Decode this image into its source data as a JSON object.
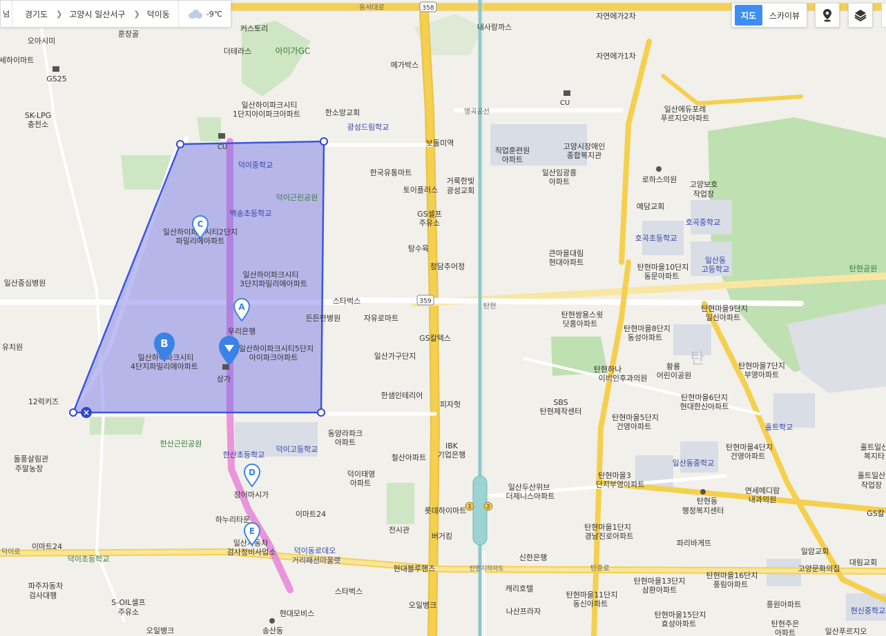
{
  "breadcrumb": {
    "edge": "넘",
    "province": "경기도",
    "city": "고양시 일산서구",
    "dong": "덕이동"
  },
  "weather": {
    "temp": "-9℃",
    "icon": "cloud-icon"
  },
  "view_toggle": {
    "map": "지도",
    "skyview": "스카이뷰",
    "selected": "지도"
  },
  "controls": {
    "location": "location-pin-icon",
    "layers": "layers-icon"
  },
  "colors": {
    "polygon_fill": "#6e6ee8",
    "polygon_stroke": "#3b55e0",
    "route": "#e889d9",
    "marker": "#3b82e6",
    "road_yellow": "#f5d04e",
    "subway": "#8fc8c8"
  },
  "markers": {
    "A": "A",
    "B": "B",
    "C": "C",
    "D": "D",
    "E": "E",
    "close": "×"
  },
  "roads": {
    "dongseo": "동서대로",
    "r358": "358",
    "r359": "359",
    "aengangongseon": "앵곡공선",
    "tanjungro": "탄중로",
    "deogiro": "덕이로",
    "ilsanro": "일산로",
    "tanhyeon_jihado": "탄현지하차도",
    "hwajeong": "화정로",
    "tanhyeonro": "탄현로",
    "misaro": "미래로",
    "tanhyeon": "탄현"
  },
  "labels": {
    "deogi_jung": "덕이중학교",
    "deogi_park": "덕이근린공원",
    "baeksong": "백송초등학교",
    "hipark2_a": "일산하이파크시티2단지",
    "hipark2_b": "파밀리에아파트",
    "hipark3_a": "일산하이파크시티",
    "hipark3_b": "3단지파밀리에아파트",
    "hipark4_a": "일산하이파크시티",
    "hipark4_b": "4단지파밀리에아파트",
    "hipark5_a": "일산하이파크시티5단지",
    "hipark5_b": "아이파크아파트",
    "hipark1_a": "일산하이파크시티",
    "hipark1_b": "1단지아이파크아파트",
    "woori": "우리은행",
    "sangga": "상가",
    "cu1": "CU",
    "cu2": "CU",
    "hansan_school": "한산초등학교",
    "deogi_high": "덕이고등학교",
    "hansan_park": "한산근린공원",
    "jangeomasi": "장어마시가",
    "hanuritaun": "하누리타운",
    "ilsan_car_a": "일산자동차",
    "ilsan_car_b": "검사정비사업소",
    "emart24_1": "이마트24",
    "emart24_2": "이마트24",
    "deogi_fashion_a": "덕이동로데오",
    "deogi_fashion_b": "거리패션아울렛",
    "deogi_elem": "덕이초등학교",
    "paju_car_a": "파주자동차",
    "paju_car_b": "검사대행",
    "soil_a": "S-OIL셀프",
    "soil_b": "주유소",
    "ohbank1": "오일뱅크",
    "ohbank2": "오일뱅크",
    "hyundai_mobis": "현대모비스",
    "songsan": "송산동",
    "starbucks1": "스타벅스",
    "starbucks2": "스타벅스",
    "hyundai_blue": "현대블루핸즈",
    "dongyang_a": "동양라파크",
    "dongyang_b": "아파트",
    "cheolsan": "철산아파트",
    "deogi_taeyoung_a": "덕이태영",
    "deogi_taeyoung_b": "아파트",
    "jeonsigwan": "전시관",
    "burgerking": "버거킹",
    "lotte_hi": "롯데하이마트",
    "ibk_a": "IBK",
    "ibk_b": "기업은행",
    "hansaem": "한샘인테리어",
    "pizzahut": "피자헛",
    "ilsangagu": "일산가구단지",
    "gs_caltex": "GS칼텍스",
    "jayu_mart": "자유로마트",
    "deunden": "든든한병원",
    "cheongdam": "청담추어정",
    "tangsuyuk": "탕수육",
    "gs_self_a": "GS셀프",
    "gs_self_b": "주유소",
    "toyplus": "토이플러스",
    "hankook_mart": "한국유통마트",
    "geoluk_a": "거룩한빛",
    "geoluk_b": "광성교회",
    "bodeul": "보돌미역",
    "gwangseong_school": "광성드림학교",
    "hansomang": "한소망교회",
    "megabox": "메가박스",
    "naesa": "내사랑까스",
    "amiga": "아미가GC",
    "terrace": "더테라스",
    "keoseutori": "커스토리",
    "hunjanggol": "훈장골",
    "oasimi": "오아시미",
    "gs25": "GS25",
    "hyeon_mart": "세하이마트",
    "sk_lpg_a": "SK-LPG",
    "sk_lpg_b": "충전소",
    "ilsan_jungsim": "일산중심병원",
    "yuchiwon": "유치원",
    "twelve_kids": "12럭키즈",
    "dolpung_a": "돌풍살림관",
    "dolpung_b": "주말농장",
    "emart24_3": "이마트24",
    "jobtraining_a": "직업훈련원",
    "jobtraining_b": "아파트",
    "goyang_welfare_a": "고양시장애인",
    "goyang_welfare_b": "종합복지관",
    "ilsan_imgwang_a": "일산임광흥",
    "ilsan_imgwang_b": "아파트",
    "keunmaeul_a": "큰마을대림",
    "keunmaeul_b": "현대아파트",
    "tanhyeon_ssangyong_a": "탄현쌍용스윗",
    "tanhyeon_ssangyong_b": "닷홈아파트",
    "sbs_a": "SBS",
    "sbs_b": "탄현제작센터",
    "ilsan_dusan_a": "일산두산위브",
    "ilsan_dusan_b": "더제니스아파트",
    "sinhan": "신한은행",
    "carry_hotel": "캐리호텔",
    "nasan_plaza": "나산프라자",
    "tanhyeon_hana_a": "탄현하나",
    "tanhyeon_hana_b": "이비인후과의원",
    "tanhyeon10_a": "탄현마을10단지",
    "tanhyeon10_b": "동문아파트",
    "tanhyeon9_a": "탄현마을9단지",
    "tanhyeon9_b": "일신아파트",
    "tanhyeon8_a": "탄현마을8단지",
    "tanhyeon8_b": "동성아파트",
    "tanhyeon7_a": "탄현마을7단지",
    "tanhyeon7_b": "부영아파트",
    "tanhyeon6_a": "탄현마을6단지",
    "tanhyeon6_b": "현대한신아파트",
    "tanhyeon5_a": "탄현마을5단지",
    "tanhyeon5_b": "건영아파트",
    "tanhyeon4_a": "탄현마을4단지",
    "tanhyeon4_b": "건영아파트",
    "tanhyeon3_a": "탄현마을3",
    "tanhyeon3_b": "단지부영아파트",
    "tanhyeon1_a": "탄현마을1단지",
    "tanhyeon1_b": "경남진로아파트",
    "tanhyeon13_a": "탄현마을13단지",
    "tanhyeon13_b": "삼환아파트",
    "tanhyeon11_a": "탄현마을11단지",
    "tanhyeon11_b": "동신아파트",
    "tanhyeon16_a": "탄현마을16단지",
    "tanhyeon16_b": "풍림아파트",
    "tanhyeon15_a": "탄현마을15단지",
    "tanhyeon15_b": "효성아파트",
    "hwanghyang_a": "황룡",
    "hwanghyang_b": "어린이공원",
    "ilsandong_jung": "일산동중학교",
    "tanhyeon_office_a": "탄현동",
    "tanhyeon_office_b": "행정복지센터",
    "yeonse_a": "연세메디람",
    "yeonse_b": "내과의원",
    "paris": "파리바게뜨",
    "ilam_church": "일암교회",
    "goyang_culture": "고양문화의집",
    "daerim_church": "대림교회",
    "pungwon": "풍원아파트",
    "tanhyeon_jueun_a": "탄현주은",
    "tanhyeon_jueun_b": "아파트",
    "ilsan_pureun": "일산푸르지오",
    "hyeonsin_jung": "현신중학교",
    "hoteu": "홀트학교",
    "hoteu_welfare_a": "홀트일산",
    "hoteu_welfare_b": "복지타",
    "hoteu_work_a": "홀트일산",
    "hoteu_work_b": "작업장",
    "gs_right": "GS칼",
    "tanhyeon_park": "탄현공원",
    "ilsan_high_a": "일산동",
    "ilsan_high_b": "고등학교",
    "hogok_elem": "호곡초등학교",
    "hogok_jung": "호곡중학교",
    "yedam": "예담교회",
    "rohas": "로하스의원",
    "goyang_bo_a": "고양보호",
    "goyang_bo_b": "작업장",
    "ilsan_edu_a": "일산에듀포레",
    "ilsan_edu_b": "푸르지오아파트",
    "jayeon2_a": "자연에가2차",
    "jayeon1": "자연에가1차",
    "cu3": "CU",
    "tan": "탄"
  }
}
